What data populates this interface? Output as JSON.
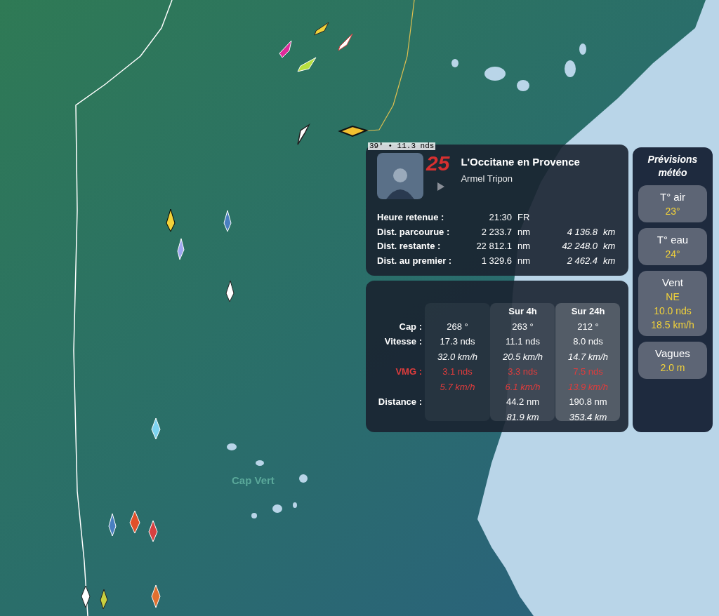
{
  "map": {
    "place_label": "Cap Vert",
    "cursor_reading": "39° • 11.3 nds"
  },
  "skipper_card": {
    "number": "25",
    "boat": "L'Occitane en Provence",
    "skipper": "Armel Tripon",
    "stats": [
      {
        "kind": "time",
        "label": "Heure retenue :",
        "value": "21:30",
        "unit": "FR"
      },
      {
        "kind": "distance",
        "label": "Dist. parcourue :",
        "value": "2 233.7",
        "unit": "nm",
        "value_km": "4 136.8",
        "unit_km": "km"
      },
      {
        "kind": "distance",
        "label": "Dist. restante :",
        "value": "22 812.1",
        "unit": "nm",
        "value_km": "42 248.0",
        "unit_km": "km"
      },
      {
        "kind": "distance",
        "label": "Dist. au premier :",
        "value": "1 329.6",
        "unit": "nm",
        "value_km": "2 462.4",
        "unit_km": "km"
      }
    ]
  },
  "performance": {
    "columns": [
      "Sur 4h",
      "Sur 24h"
    ],
    "rows": [
      {
        "label": "Cap :",
        "highlight": false,
        "values": [
          "268 °",
          "263 °",
          "212 °"
        ]
      },
      {
        "label": "Vitesse :",
        "highlight": false,
        "values": [
          "17.3 nds",
          "11.1 nds",
          "8.0 nds"
        ],
        "sub_values": [
          "32.0 km/h",
          "20.5 km/h",
          "14.7 km/h"
        ]
      },
      {
        "label": "VMG :",
        "highlight": true,
        "values": [
          "3.1 nds",
          "3.3 nds",
          "7.5 nds"
        ],
        "sub_values": [
          "5.7 km/h",
          "6.1 km/h",
          "13.9 km/h"
        ]
      },
      {
        "label": "Distance :",
        "highlight": false,
        "values": [
          "44.2 nm",
          "190.8 nm"
        ],
        "sub_values": [
          "81.9 km",
          "353.4 km"
        ]
      }
    ]
  },
  "weather": {
    "title": "Prévisions météo",
    "cards": [
      {
        "label": "T° air",
        "values": [
          "23°"
        ]
      },
      {
        "label": "T° eau",
        "values": [
          "24°"
        ]
      },
      {
        "label": "Vent",
        "values": [
          "NE",
          "10.0 nds",
          "18.5 km/h"
        ]
      },
      {
        "label": "Vagues",
        "values": [
          "2.0 m"
        ]
      }
    ]
  }
}
